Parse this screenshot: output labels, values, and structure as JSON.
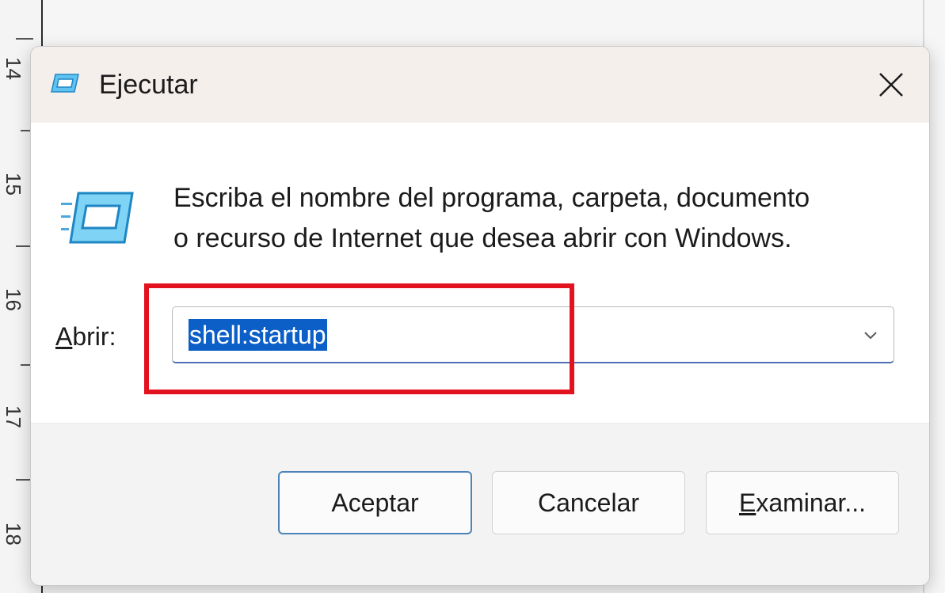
{
  "dialog": {
    "title": "Ejecutar",
    "prompt_line1": "Escriba el nombre del programa, carpeta, documento",
    "prompt_line2": "o recurso de Internet que desea abrir con Windows.",
    "open_label_mnemonic": "A",
    "open_label_rest": "brir:",
    "open_value": "shell:startup",
    "buttons": {
      "ok": "Aceptar",
      "cancel": "Cancelar",
      "browse_mnemonic": "E",
      "browse_rest": "xaminar..."
    }
  },
  "background": {
    "ruler_numbers": [
      "14",
      "15",
      "16",
      "17",
      "18"
    ]
  },
  "icons": {
    "title": "run-dialog-icon",
    "body": "run-program-icon",
    "close": "close-icon",
    "dropdown": "chevron-down-icon"
  },
  "colors": {
    "title_bar": "#f5efec",
    "selection": "#0b5fc7",
    "highlight": "#e2131f",
    "primary_border": "#4d83b8",
    "footer": "#f3f3f3"
  }
}
